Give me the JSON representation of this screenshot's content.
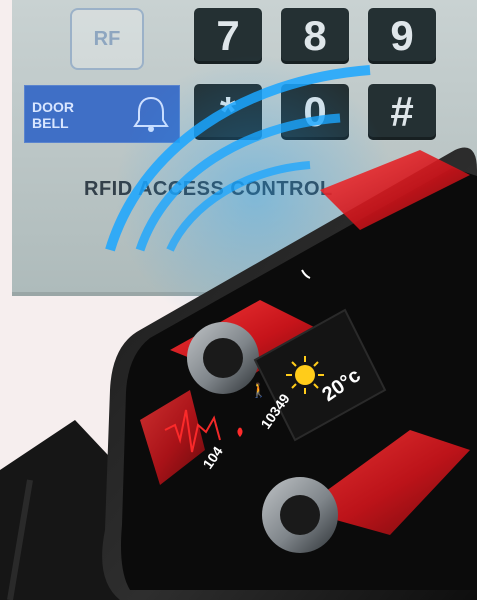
{
  "panel": {
    "rf_label": "RF",
    "doorbell_label": "DOOR\nBELL",
    "keys": [
      "7",
      "8",
      "9",
      "*",
      "0",
      "#"
    ],
    "title": "RFID ACCESS CONTROL"
  },
  "watch": {
    "temperature": "20°c",
    "steps": "10349",
    "heart_rate": "104"
  },
  "colors": {
    "accent_red": "#d0141b",
    "nfc_wave": "#1aa6ff",
    "doorbell_blue": "#3f6fc6"
  }
}
